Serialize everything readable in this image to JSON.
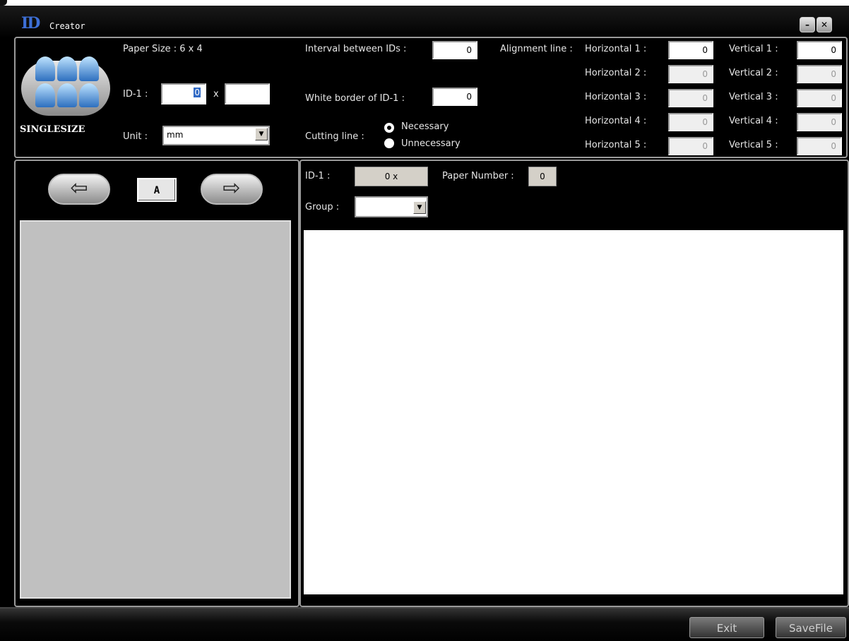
{
  "window": {
    "title": "Creator",
    "logo_text": "ID"
  },
  "settings": {
    "paper_size_label": "Paper Size : 6 x 4",
    "singlesize_label": "SINGLESIZE",
    "id1_label": "ID-1 :",
    "id1_width": "0",
    "id1_x": "x",
    "id1_height": "",
    "unit_label": "Unit :",
    "unit_value": "mm",
    "interval_label": "Interval between IDs :",
    "interval_value": "0",
    "white_border_label": "White border of ID-1 :",
    "white_border_value": "0",
    "cutting_line_label": "Cutting line :",
    "cutting_options": [
      "Necessary",
      "Unnecessary"
    ],
    "alignment_label": "Alignment line :"
  },
  "alignment": {
    "horizontal": [
      {
        "label": "Horizontal 1 :",
        "value": "0"
      },
      {
        "label": "Horizontal 2 :",
        "value": "0"
      },
      {
        "label": "Horizontal 3 :",
        "value": "0"
      },
      {
        "label": "Horizontal 4 :",
        "value": "0"
      },
      {
        "label": "Horizontal 5 :",
        "value": "0"
      }
    ],
    "vertical": [
      {
        "label": "Vertical 1 :",
        "value": "0"
      },
      {
        "label": "Vertical 2 :",
        "value": "0"
      },
      {
        "label": "Vertical 3 :",
        "value": "0"
      },
      {
        "label": "Vertical 4 :",
        "value": "0"
      },
      {
        "label": "Vertical 5 :",
        "value": "0"
      }
    ]
  },
  "nav": {
    "page_label": "A",
    "prev_icon": "left-arrow-icon",
    "next_icon": "right-arrow-icon"
  },
  "preview": {
    "id1_label": "ID-1 :",
    "id1_value": "0 x",
    "paper_number_label": "Paper Number :",
    "paper_number_value": "0",
    "group_label": "Group :",
    "group_value": ""
  },
  "footer": {
    "exit_label": "Exit",
    "save_label": "SaveFile"
  },
  "colors": {
    "background": "#000000",
    "panel_border": "#9a9a9a",
    "logo": "#3d6fd6"
  }
}
